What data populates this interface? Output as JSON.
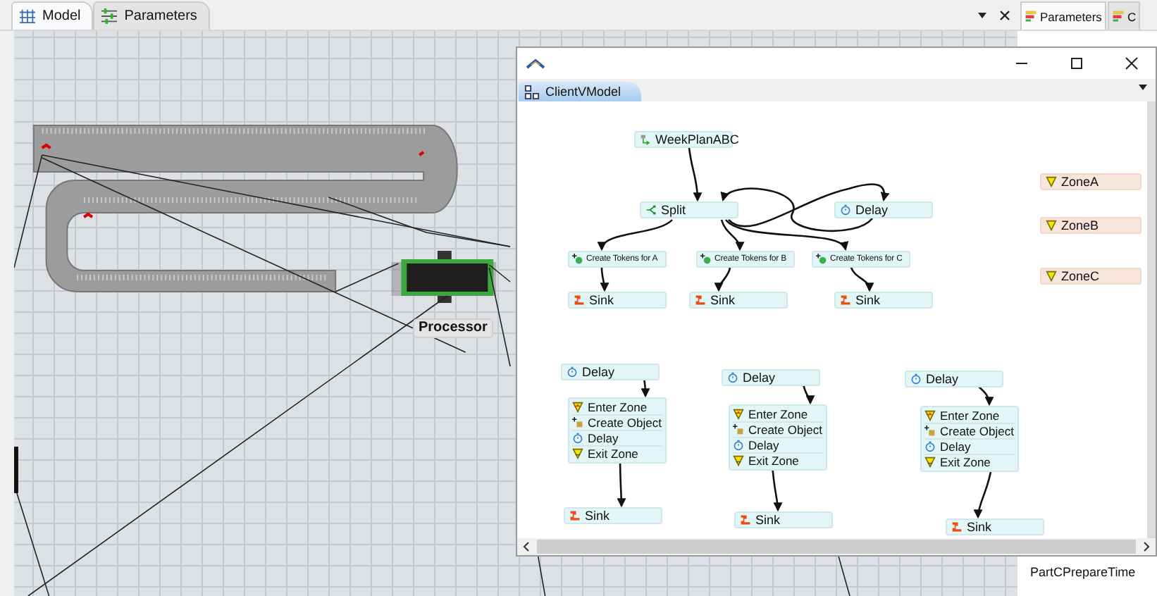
{
  "model_tabs": [
    {
      "label": "Model",
      "selected": true
    },
    {
      "label": "Parameters",
      "selected": false
    }
  ],
  "processor_label": "Processor",
  "right_panel": {
    "tabs": [
      {
        "label": "Parameters",
        "selected": true
      },
      {
        "label": "C",
        "selected": false
      }
    ],
    "items": [
      "PartCPrepareTime"
    ]
  },
  "process_window": {
    "tab": "ClientVModel",
    "nodes": [
      {
        "kind": "source",
        "label": "WeekPlanABC"
      },
      {
        "kind": "split",
        "label": "Split"
      },
      {
        "kind": "delay",
        "label": "Delay"
      },
      {
        "kind": "create_tokens",
        "label": "Create Tokens for A"
      },
      {
        "kind": "create_tokens",
        "label": "Create Tokens for B"
      },
      {
        "kind": "create_tokens",
        "label": "Create Tokens for C"
      },
      {
        "kind": "sink",
        "label": "Sink"
      },
      {
        "kind": "sink",
        "label": "Sink"
      },
      {
        "kind": "sink",
        "label": "Sink"
      },
      {
        "kind": "zone",
        "label": "ZoneA"
      },
      {
        "kind": "zone",
        "label": "ZoneB"
      },
      {
        "kind": "zone",
        "label": "ZoneC"
      },
      {
        "kind": "delay",
        "label": "Delay"
      },
      {
        "kind": "delay",
        "label": "Delay"
      },
      {
        "kind": "delay",
        "label": "Delay"
      },
      {
        "kind": "block",
        "activities": [
          {
            "kind": "enter_zone",
            "label": "Enter Zone"
          },
          {
            "kind": "create_object",
            "label": "Create Object"
          },
          {
            "kind": "delay",
            "label": "Delay"
          },
          {
            "kind": "exit_zone",
            "label": "Exit Zone"
          }
        ]
      },
      {
        "kind": "block",
        "activities": [
          {
            "kind": "enter_zone",
            "label": "Enter Zone"
          },
          {
            "kind": "create_object",
            "label": "Create Object"
          },
          {
            "kind": "delay",
            "label": "Delay"
          },
          {
            "kind": "exit_zone",
            "label": "Exit Zone"
          }
        ]
      },
      {
        "kind": "block",
        "activities": [
          {
            "kind": "enter_zone",
            "label": "Enter Zone"
          },
          {
            "kind": "create_object",
            "label": "Create Object"
          },
          {
            "kind": "delay",
            "label": "Delay"
          },
          {
            "kind": "exit_zone",
            "label": "Exit Zone"
          }
        ]
      },
      {
        "kind": "sink",
        "label": "Sink"
      },
      {
        "kind": "sink",
        "label": "Sink"
      },
      {
        "kind": "sink",
        "label": "Sink"
      }
    ]
  }
}
